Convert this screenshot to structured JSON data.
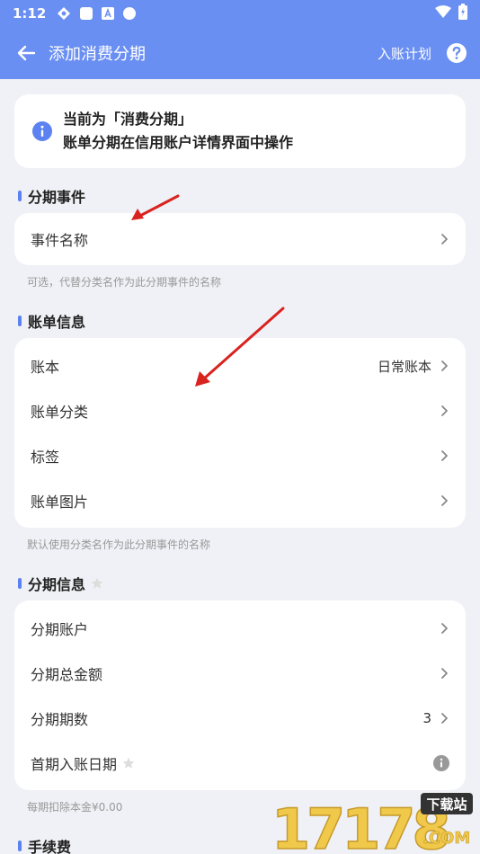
{
  "status": {
    "time": "1:12"
  },
  "appbar": {
    "title": "添加消费分期",
    "plan_link": "入账计划"
  },
  "info": {
    "line1": "当前为「消费分期」",
    "line2": "账单分期在信用账户详情界面中操作"
  },
  "sections": {
    "event": {
      "title": "分期事件",
      "row_name": "事件名称",
      "hint": "可选，代替分类名作为此分期事件的名称"
    },
    "bill": {
      "title": "账单信息",
      "book_label": "账本",
      "book_value": "日常账本",
      "category_label": "账单分类",
      "tag_label": "标签",
      "image_label": "账单图片",
      "hint": "默认使用分类名作为此分期事件的名称"
    },
    "installment": {
      "title": "分期信息",
      "account_label": "分期账户",
      "total_label": "分期总金额",
      "periods_label": "分期期数",
      "periods_value": "3",
      "first_date_label": "首期入账日期",
      "hint": "每期扣除本金¥0.00"
    },
    "fee": {
      "title": "手续费"
    }
  },
  "watermark": {
    "number": "17178",
    "badge": "下载站",
    "com": ".COM"
  },
  "colors": {
    "accent": "#6a8ff2",
    "section_bar": "#5b82f0",
    "arrow": "#d9231f"
  }
}
